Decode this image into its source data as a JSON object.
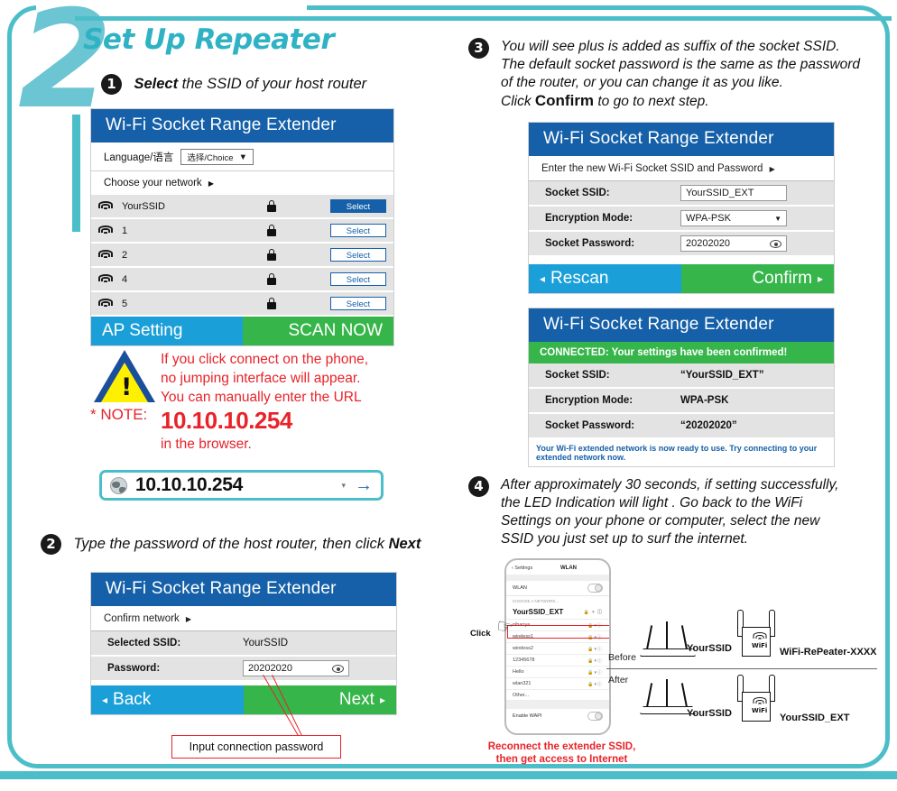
{
  "section": {
    "number": "2",
    "title": "Set Up Repeater"
  },
  "theme": {
    "teal": "#4cbec9",
    "panel_blue": "#1560a8",
    "button_blue": "#1a9fd9",
    "button_green": "#36b54a",
    "alert_red": "#e8232a",
    "warning_yellow": "#fff000"
  },
  "step1": {
    "badge": "1",
    "lead": "Select",
    "rest": " the SSID of your host router",
    "panel": {
      "header": "Wi-Fi Socket Range Extender",
      "language_label": "Language/语言",
      "language_value": "选择/Choice",
      "language_caret": "▼",
      "choose_label": "Choose your network",
      "choose_caret": "▶",
      "networks": [
        {
          "ssid": "YourSSID",
          "locked": true,
          "button": "Select",
          "active": true,
          "signal": 3
        },
        {
          "ssid": "1",
          "locked": true,
          "button": "Select",
          "active": false,
          "signal": 2
        },
        {
          "ssid": "2",
          "locked": true,
          "button": "Select",
          "active": false,
          "signal": 3
        },
        {
          "ssid": "4",
          "locked": true,
          "button": "Select",
          "active": false,
          "signal": 2
        },
        {
          "ssid": "5",
          "locked": true,
          "button": "Select",
          "active": false,
          "signal": 1
        }
      ],
      "foot_left": "AP Setting",
      "foot_right": "SCAN NOW"
    }
  },
  "note": {
    "label": "* NOTE:",
    "line1": "If you click connect on the phone,",
    "line2": "no jumping interface will appear.",
    "line3": "You can manually enter the URL",
    "ip": "10.10.10.254",
    "line4": "in the browser.",
    "warning_glyph": "!"
  },
  "browser": {
    "url": "10.10.10.254",
    "caret": "▾",
    "go": "→",
    "icon": "globe-icon"
  },
  "step2": {
    "badge": "2",
    "text_before": "Type the password of the host router,  then click ",
    "text_bold": "Next",
    "panel": {
      "header": "Wi-Fi Socket Range Extender",
      "sub": "Confirm network",
      "sub_caret": "▶",
      "rows": [
        {
          "label": "Selected SSID:",
          "value": "YourSSID",
          "type": "text"
        },
        {
          "label": "Password:",
          "value": "20202020",
          "type": "password-field"
        }
      ],
      "foot_left": "Back",
      "foot_left_caret": "◂",
      "foot_right": "Next",
      "foot_right_caret": "▸"
    },
    "callout": "Input connection password"
  },
  "step3": {
    "badge": "3",
    "line1": "You will see plus is added as suffix of the socket SSID.",
    "line2": "The default socket password is the same as the password",
    "line3": "of the router, or you can change it as you like.",
    "line4_pre": "Click ",
    "line4_bold": "Confirm",
    "line4_post": " to go to next step.",
    "panel_form": {
      "header": "Wi-Fi Socket Range Extender",
      "sub": "Enter the new Wi-Fi Socket SSID and Password",
      "sub_caret": "▶",
      "rows": [
        {
          "label": "Socket SSID:",
          "value": "YourSSID_EXT",
          "type": "text-field"
        },
        {
          "label": "Encryption Mode:",
          "value": "WPA-PSK",
          "type": "select",
          "caret": "▼"
        },
        {
          "label": "Socket Password:",
          "value": "20202020",
          "type": "password-field"
        }
      ],
      "foot_left": "Rescan",
      "foot_left_caret": "◂",
      "foot_right": "Confirm",
      "foot_right_caret": "▸"
    },
    "panel_confirmed": {
      "header": "Wi-Fi Socket Range Extender",
      "banner": "CONNECTED: Your settings have been confirmed!",
      "rows": [
        {
          "label": "Socket SSID:",
          "value": "“YourSSID_EXT”"
        },
        {
          "label": "Encryption Mode:",
          "value": "WPA-PSK"
        },
        {
          "label": "Socket Password:",
          "value": "“20202020”"
        }
      ],
      "footnote": "Your Wi-Fi extended network is now ready to use. Try connecting to your extended network now."
    }
  },
  "step4": {
    "badge": "4",
    "line1": "After approximately 30 seconds, if setting successfully,",
    "line2": "the LED Indication will light . Go back to the WiFi",
    "line3": "Settings on your phone or computer, select the new",
    "line4": "SSID you just set up to surf the internet.",
    "phone": {
      "back": "‹ Settings",
      "title": "WLAN",
      "toggle_label": "WLAN",
      "section_header": "CHOOSE A NETWORK...",
      "selected": "YourSSID_EXT",
      "items": [
        "nihaoya",
        "wireless1",
        "wireless2",
        "12345678",
        "Hello",
        "wlan321",
        "Other..."
      ],
      "footer_label": "Enable WAPI"
    },
    "click_label": "Click",
    "diagram": {
      "before_label": "Before",
      "after_label": "After",
      "before_router": "YourSSID",
      "before_extender": "WiFi-RePeater-XXXX",
      "after_router": "YourSSID",
      "after_extender": "YourSSID_EXT",
      "device_glyph": "WiFi"
    },
    "reconnect_line1": "Reconnect the extender SSID,",
    "reconnect_line2": "then get access to Internet"
  }
}
